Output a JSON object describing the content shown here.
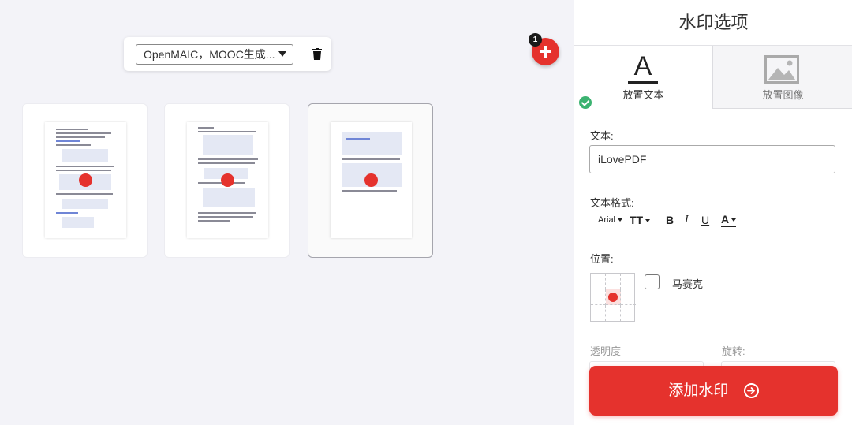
{
  "workspace": {
    "file_select": {
      "selected": "OpenMAIC，MOOC生成..."
    },
    "file_count": "1",
    "pages": [
      {
        "name": "page-1",
        "selected": false
      },
      {
        "name": "page-2",
        "selected": false
      },
      {
        "name": "page-3",
        "selected": true
      }
    ]
  },
  "panel": {
    "title": "水印选项",
    "tabs": {
      "text": "放置文本",
      "image": "放置图像"
    },
    "text_label": "文本:",
    "text_value": "iLovePDF",
    "format_label": "文本格式:",
    "format": {
      "font": "Arial",
      "size_glyph": "TT",
      "bold": "B",
      "italic": "I",
      "underline": "U",
      "color": "A"
    },
    "position_label": "位置:",
    "position": {
      "selected_cell": "center"
    },
    "mosaic_label": "马赛克",
    "mosaic_checked": false,
    "opacity_label": "透明度",
    "rotation_label": "旋转:",
    "apply_button": "添加水印"
  },
  "colors": {
    "accent": "#e5322d",
    "check_green": "#3cb371",
    "panel_bg": "#ffffff",
    "workspace_bg": "#f3f3f8"
  }
}
